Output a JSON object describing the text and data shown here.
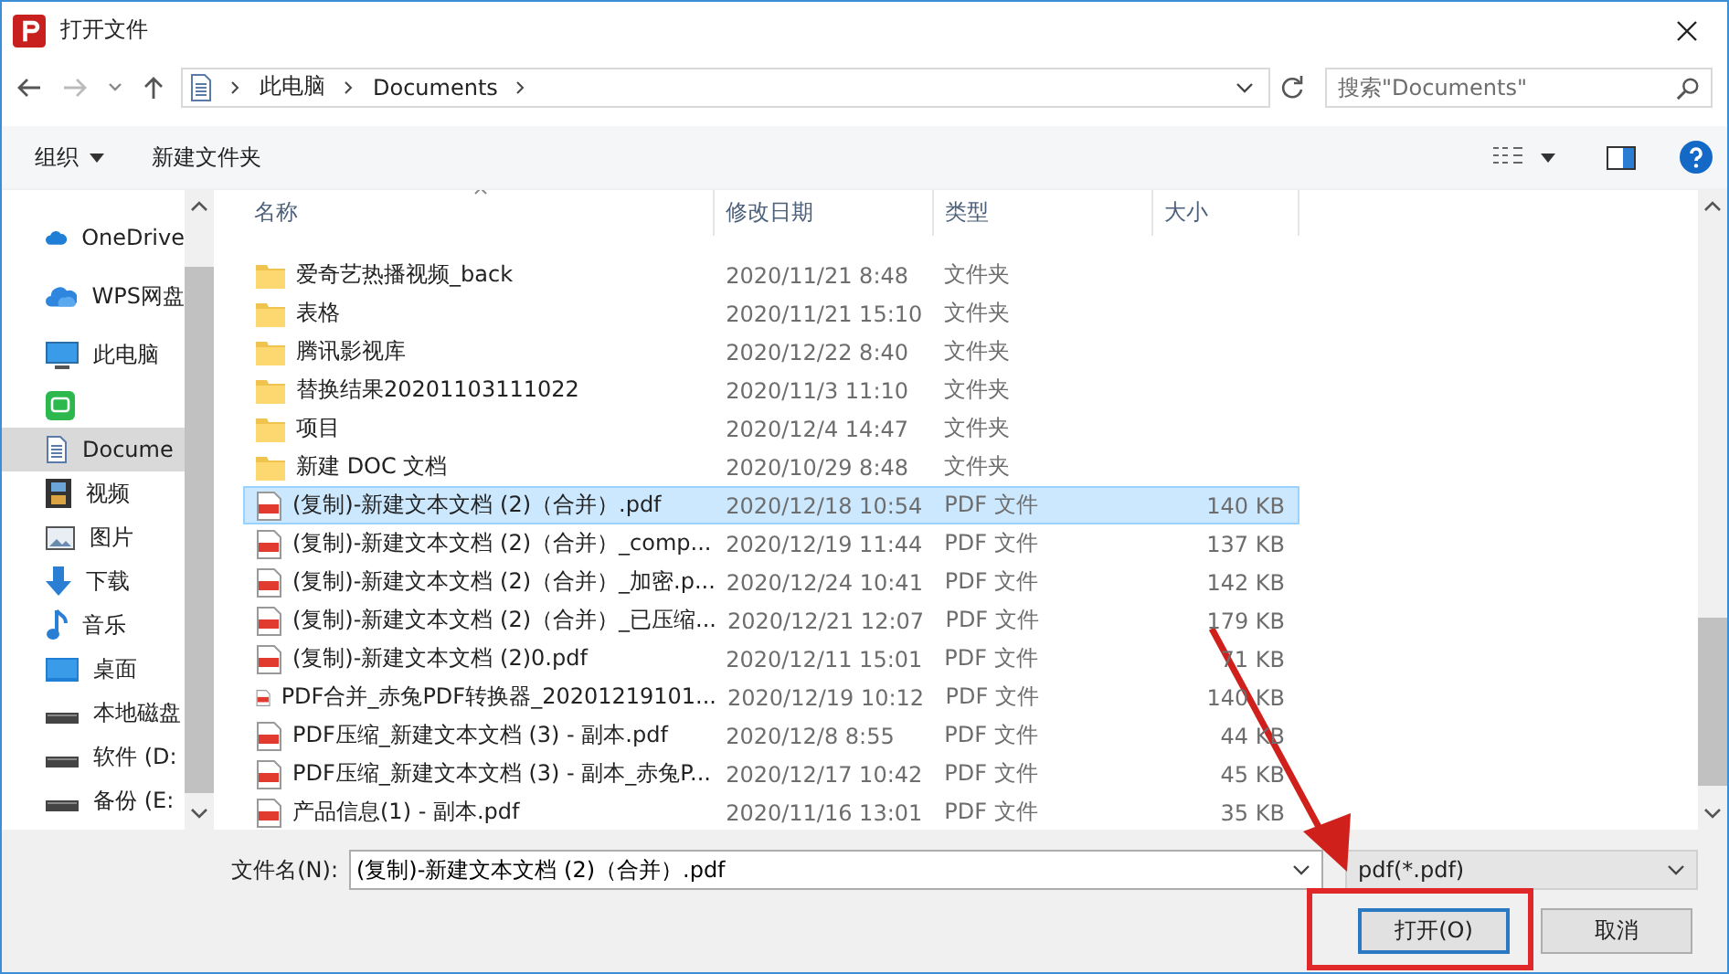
{
  "window": {
    "title": "打开文件"
  },
  "address": {
    "crumbs": [
      "此电脑",
      "Documents"
    ]
  },
  "search": {
    "placeholder": "搜索\"Documents\""
  },
  "toolbar": {
    "organize": "组织",
    "new_folder": "新建文件夹"
  },
  "sidebar": {
    "items": [
      {
        "label": "OneDrive",
        "selected": false
      },
      {
        "label": "WPS网盘",
        "selected": false
      },
      {
        "label": "此电脑",
        "selected": false
      },
      {
        "selected": false
      },
      {
        "label": "Docume",
        "selected": true
      },
      {
        "label": "视频",
        "selected": false
      },
      {
        "label": "图片",
        "selected": false
      },
      {
        "label": "下载",
        "selected": false
      },
      {
        "label": "音乐",
        "selected": false
      },
      {
        "label": "桌面",
        "selected": false
      },
      {
        "label": "本地磁盘",
        "selected": false
      },
      {
        "label": "软件 (D:",
        "selected": false
      },
      {
        "label": "备份 (E:",
        "selected": false
      }
    ]
  },
  "table": {
    "columns": [
      "名称",
      "修改日期",
      "类型",
      "大小"
    ],
    "rows": [
      {
        "kind": "folder",
        "name": "爱奇艺热播视频_back",
        "date": "2020/11/21 8:48",
        "type": "文件夹",
        "selected": false
      },
      {
        "kind": "folder",
        "name": "表格",
        "date": "2020/11/21 15:10",
        "type": "文件夹",
        "selected": false
      },
      {
        "kind": "folder",
        "name": "腾讯影视库",
        "date": "2020/12/22 8:40",
        "type": "文件夹",
        "selected": false
      },
      {
        "kind": "folder",
        "name": "替换结果20201103111022",
        "date": "2020/11/3 11:10",
        "type": "文件夹",
        "selected": false
      },
      {
        "kind": "folder",
        "name": "项目",
        "date": "2020/12/4 14:47",
        "type": "文件夹",
        "selected": false
      },
      {
        "kind": "folder",
        "name": "新建 DOC 文档",
        "date": "2020/10/29 8:48",
        "type": "文件夹",
        "selected": false
      },
      {
        "kind": "pdf",
        "name": "(复制)-新建文本文档 (2)（合并）.pdf",
        "date": "2020/12/18 10:54",
        "type": "PDF 文件",
        "size": "140 KB",
        "selected": true
      },
      {
        "kind": "pdf",
        "name": "(复制)-新建文本文档 (2)（合并）_comp...",
        "date": "2020/12/19 11:44",
        "type": "PDF 文件",
        "size": "137 KB",
        "selected": false
      },
      {
        "kind": "pdf",
        "name": "(复制)-新建文本文档 (2)（合并）_加密.p...",
        "date": "2020/12/24 10:41",
        "type": "PDF 文件",
        "size": "142 KB",
        "selected": false
      },
      {
        "kind": "pdf",
        "name": "(复制)-新建文本文档 (2)（合并）_已压缩...",
        "date": "2020/12/21 12:07",
        "type": "PDF 文件",
        "size": "179 KB",
        "selected": false
      },
      {
        "kind": "pdf",
        "name": "(复制)-新建文本文档 (2)0.pdf",
        "date": "2020/12/11 15:01",
        "type": "PDF 文件",
        "size": "71 KB",
        "selected": false
      },
      {
        "kind": "pdf",
        "name": "PDF合并_赤兔PDF转换器_20201219101...",
        "date": "2020/12/19 10:12",
        "type": "PDF 文件",
        "size": "140 KB",
        "selected": false
      },
      {
        "kind": "pdf",
        "name": "PDF压缩_新建文本文档 (3) - 副本.pdf",
        "date": "2020/12/8 8:55",
        "type": "PDF 文件",
        "size": "44 KB",
        "selected": false
      },
      {
        "kind": "pdf",
        "name": "PDF压缩_新建文本文档 (3) - 副本_赤兔P...",
        "date": "2020/12/17 10:42",
        "type": "PDF 文件",
        "size": "45 KB",
        "selected": false
      },
      {
        "kind": "pdf",
        "name": "产品信息(1) - 副本.pdf",
        "date": "2020/11/16 13:01",
        "type": "PDF 文件",
        "size": "35 KB",
        "selected": false
      }
    ]
  },
  "footer": {
    "filename_label": "文件名(N):",
    "filename": "(复制)-新建文本文档 (2)（合并）.pdf",
    "filter": "pdf(*.pdf)",
    "open": "打开(O)",
    "cancel": "取消"
  },
  "annotation": {
    "arrow": true,
    "highlight_box": true
  }
}
